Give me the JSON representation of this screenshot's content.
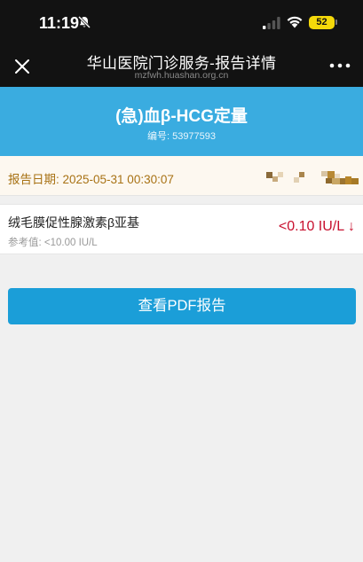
{
  "status_bar": {
    "time": "11:19",
    "battery": "52",
    "icons": [
      "bell-slash-icon",
      "cellular-signal-icon",
      "wifi-icon",
      "battery-icon"
    ]
  },
  "nav": {
    "title": "华山医院门诊服务-报告详情",
    "subtitle": "mzfwh.huashan.org.cn",
    "icons": [
      "close-icon",
      "more-icon"
    ]
  },
  "report": {
    "test_name": "(急)血β-HCG定量",
    "report_no": "编号: 53977593",
    "date": "报告日期: 2025-05-31 00:30:07"
  },
  "result": {
    "item_name": "绒毛膜促性腺激素β亚基",
    "reference": "参考值: <10.00 IU/L",
    "value": "<0.10 IU/L ↓"
  },
  "actions": {
    "view_pdf": "查看PDF报告"
  },
  "colors": {
    "status_bg": "#121212",
    "banner": "#3aace0",
    "button": "#1b9ed8",
    "date_text": "#a87214",
    "result_low": "#c8102e",
    "battery": "#f5d90a",
    "page_bg": "#f0f0f0"
  }
}
